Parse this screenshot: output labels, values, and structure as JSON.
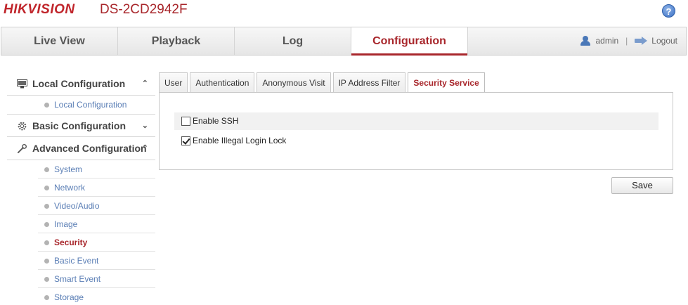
{
  "brand": {
    "logo": "HIKVISION",
    "model": "DS-2CD2942F",
    "help_glyph": "?"
  },
  "nav": {
    "tabs": [
      {
        "label": "Live View"
      },
      {
        "label": "Playback"
      },
      {
        "label": "Log"
      },
      {
        "label": "Configuration",
        "active": true
      }
    ],
    "user": "admin",
    "separator": "|",
    "logout": "Logout"
  },
  "sidebar": {
    "sections": [
      {
        "label": "Local Configuration",
        "expanded": true,
        "items": [
          "Local Configuration"
        ]
      },
      {
        "label": "Basic Configuration",
        "expanded": false,
        "items": []
      },
      {
        "label": "Advanced Configuration",
        "expanded": true,
        "items": [
          "System",
          "Network",
          "Video/Audio",
          "Image",
          "Security",
          "Basic Event",
          "Smart Event",
          "Storage"
        ],
        "active_item": "Security"
      }
    ]
  },
  "content": {
    "tabs": [
      "User",
      "Authentication",
      "Anonymous Visit",
      "IP Address Filter",
      "Security Service"
    ],
    "active_tab": "Security Service",
    "options": [
      {
        "label": "Enable SSH",
        "checked": false
      },
      {
        "label": "Enable Illegal Login Lock",
        "checked": true
      }
    ],
    "save_label": "Save"
  },
  "colors": {
    "accent": "#a8262b",
    "link": "#5a7eb5",
    "logo": "#c0252b"
  }
}
